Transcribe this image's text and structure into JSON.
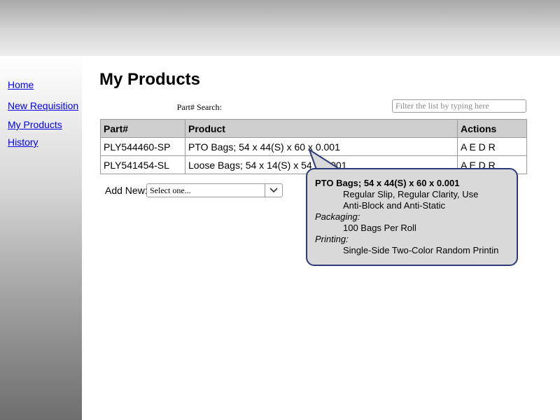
{
  "sidebar": {
    "items": [
      {
        "label": "Home"
      },
      {
        "label": "New Requisition"
      },
      {
        "label": "My Products"
      },
      {
        "label": "History"
      }
    ]
  },
  "main": {
    "title": "My Products",
    "search": {
      "label": "Part# Search:",
      "placeholder": "Filter the list by typing here",
      "value": ""
    },
    "table": {
      "headers": [
        "Part#",
        "Product",
        "Actions"
      ],
      "rows": [
        {
          "part": "PLY544460-SP",
          "product": "PTO Bags; 54 x 44(S) x 60 x 0.001",
          "actions": "A E D R"
        },
        {
          "part": "PLY541454-SL",
          "product": "Loose Bags; 54 x 14(S) x 54 x 0.001",
          "actions": "A E D R"
        }
      ]
    },
    "add_new": {
      "label": "Add New:",
      "selected": "Select one..."
    }
  },
  "tooltip": {
    "title": "PTO Bags; 54 x 44(S) x 60 x 0.001",
    "desc_line1": "Regular Slip, Regular Clarity, Use",
    "desc_line2": "Anti-Block and Anti-Static",
    "packaging_label": "Packaging:",
    "packaging_value": "100 Bags Per Roll",
    "printing_label": "Printing:",
    "printing_value": "Single-Side Two-Color Random Printin"
  },
  "icons": {
    "dropdown": "chevron-down-icon"
  },
  "colors": {
    "link": "#0000ee",
    "tooltip_border": "#2e3a7a",
    "tooltip_bg": "#d9d9d9",
    "table_header_bg": "#cfcfcf"
  }
}
